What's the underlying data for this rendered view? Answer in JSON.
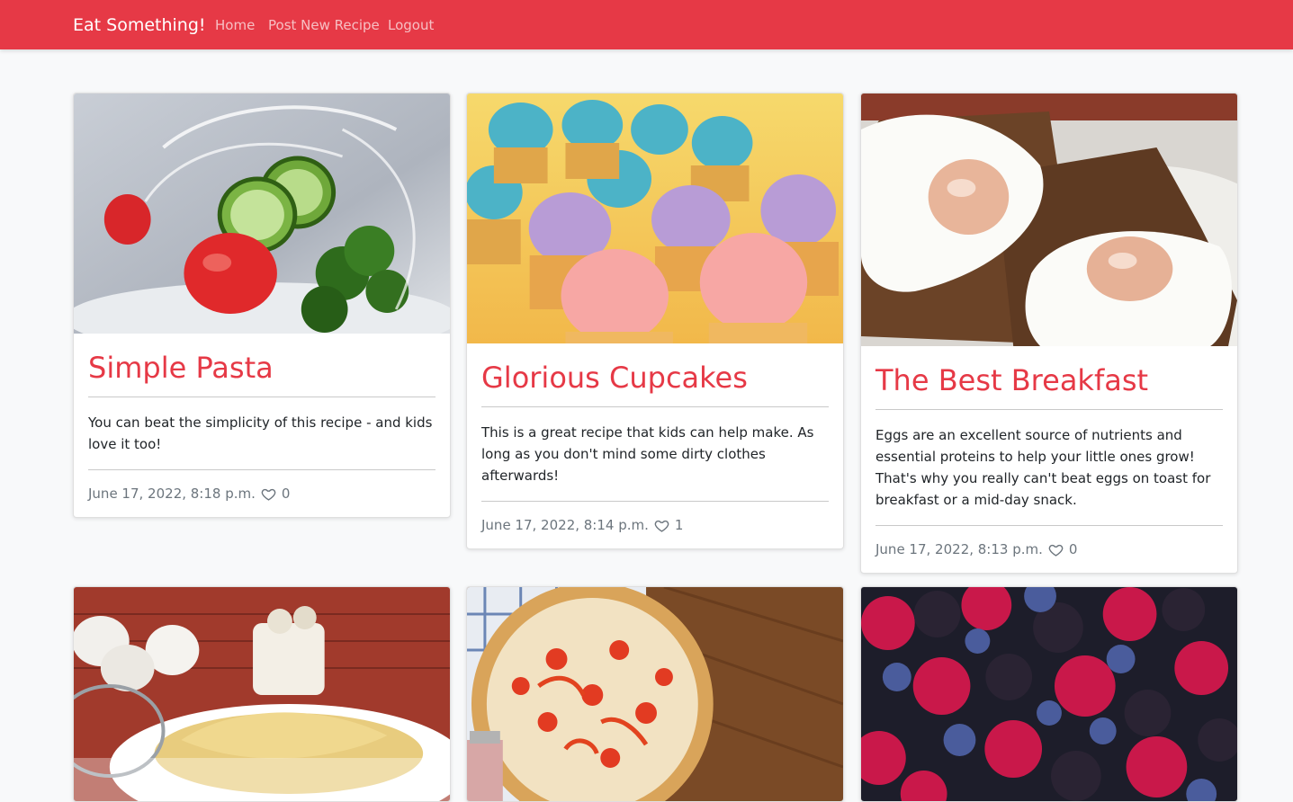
{
  "nav": {
    "brand": "Eat Something!",
    "links": [
      "Home",
      "Post New Recipe",
      "Logout"
    ]
  },
  "colors": {
    "accent": "#e63946",
    "background": "#f8f9fa"
  },
  "cards": [
    {
      "title": "Simple Pasta",
      "description": "You can beat the simplicity of this recipe - and kids love it too!",
      "date": "June 17, 2022, 8:18 p.m.",
      "likes": "0",
      "image": "vegetables-water-splash"
    },
    {
      "title": "Glorious Cupcakes",
      "description": "This is a great recipe that kids can help make. As long as you don't mind some dirty clothes afterwards!",
      "date": "June 17, 2022, 8:14 p.m.",
      "likes": "1",
      "image": "pastel-cupcakes"
    },
    {
      "title": "The Best Breakfast",
      "description": "Eggs are an excellent source of nutrients and essential proteins to help your little ones grow! That's why you really can't beat eggs on toast for breakfast or a mid-day snack.",
      "date": "June 17, 2022, 8:13 p.m.",
      "likes": "0",
      "image": "fried-eggs-on-toast"
    },
    {
      "image": "crepes-on-plate"
    },
    {
      "image": "pizza-on-board"
    },
    {
      "image": "mixed-berries"
    }
  ]
}
